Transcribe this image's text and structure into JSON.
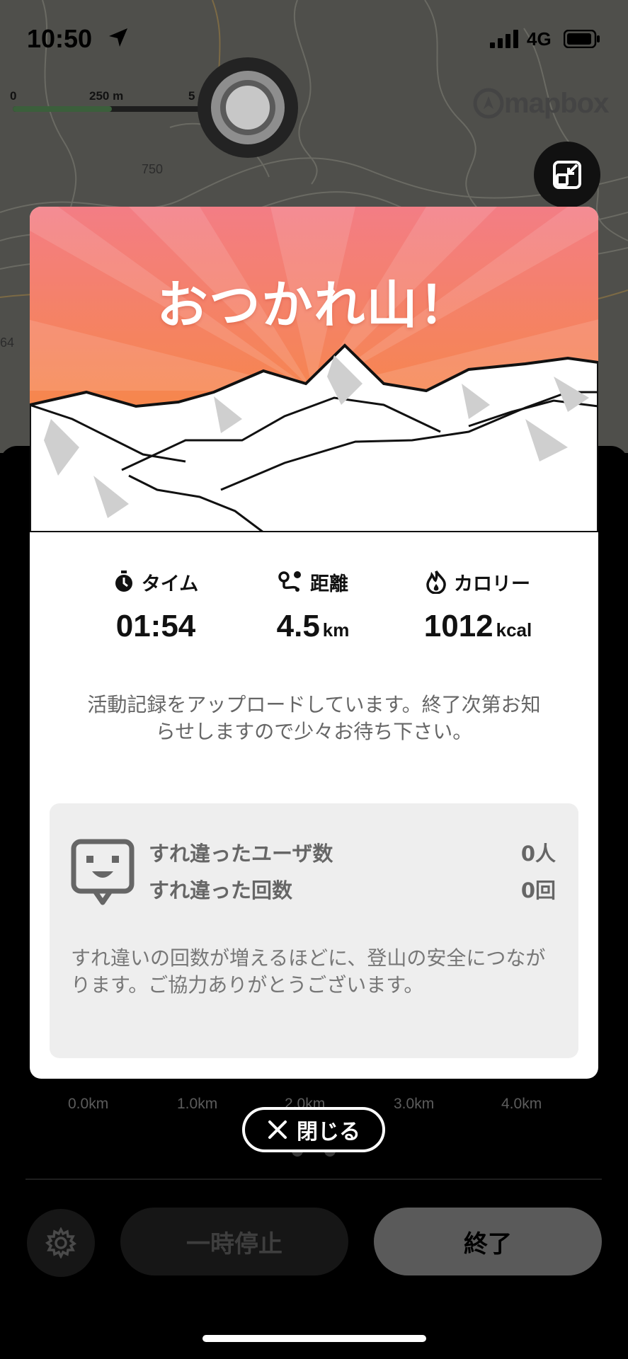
{
  "status_bar": {
    "time": "10:50",
    "network": "4G"
  },
  "map": {
    "scale": {
      "start": "0",
      "mid": "250 m",
      "end": "5"
    },
    "attribution": "mapbox",
    "contour_labels": [
      "750",
      "64"
    ]
  },
  "dialog": {
    "title": "おつかれ山！",
    "stats": [
      {
        "icon": "stopwatch-icon",
        "label": "タイム",
        "value": "01:54",
        "unit": ""
      },
      {
        "icon": "route-icon",
        "label": "距離",
        "value": "4.5",
        "unit": "km"
      },
      {
        "icon": "flame-icon",
        "label": "カロリー",
        "value": "1012",
        "unit": "kcal"
      }
    ],
    "upload_message": "活動記録をアップロードしています。終了次第お知らせしますので少々お待ち下さい。",
    "pass": {
      "users_label": "すれ違ったユーザ数",
      "users_value": "0人",
      "count_label": "すれ違った回数",
      "count_value": "0回",
      "note": "すれ違いの回数が増えるほどに、登山の安全につながります。ご協力ありがとうございます。"
    }
  },
  "chart_axis": [
    "0.0km",
    "1.0km",
    "2.0km",
    "3.0km",
    "4.0km"
  ],
  "close_label": "閉じる",
  "bottom_bar": {
    "pause_label": "一時停止",
    "finish_label": "終了"
  },
  "colors": {
    "header_top": "#f47f83",
    "header_bottom": "#f68a3a",
    "panel": "#000000"
  }
}
